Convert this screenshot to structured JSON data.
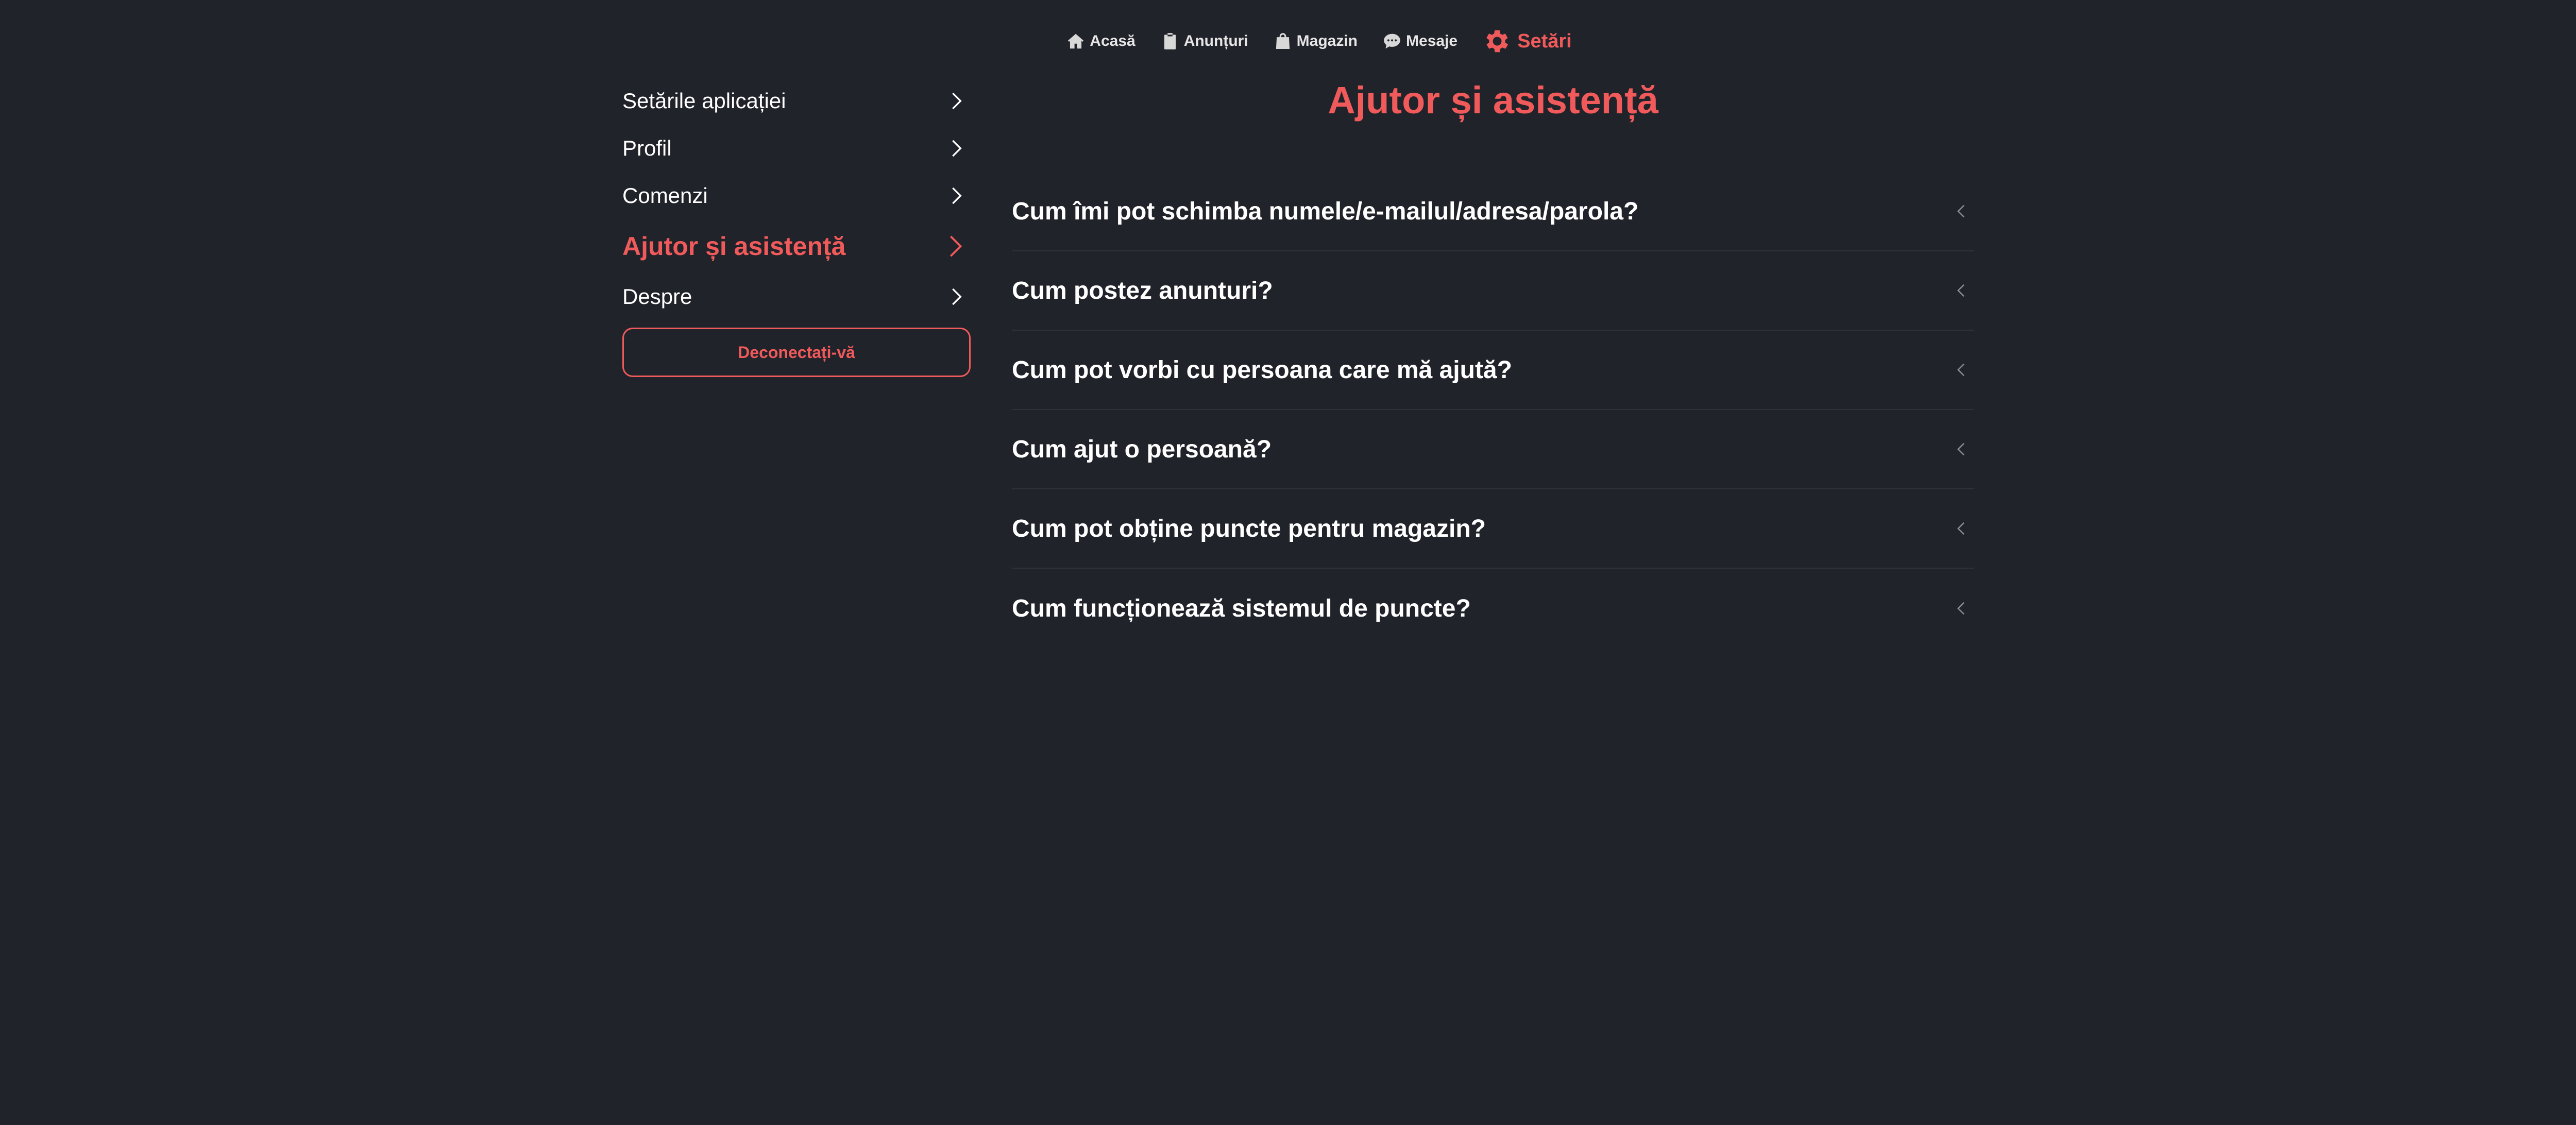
{
  "colors": {
    "background": "#21232a",
    "accent": "#f05a5b",
    "text": "#ffffff",
    "nav_text": "#e6e6e6",
    "divider": "#2f323a"
  },
  "topnav": {
    "items": [
      {
        "label": "Acasă",
        "icon": "home-icon",
        "active": false
      },
      {
        "label": "Anunțuri",
        "icon": "clipboard-icon",
        "active": false
      },
      {
        "label": "Magazin",
        "icon": "shopping-bag-icon",
        "active": false
      },
      {
        "label": "Mesaje",
        "icon": "chat-bubble-icon",
        "active": false
      },
      {
        "label": "Setări",
        "icon": "gear-icon",
        "active": true
      }
    ]
  },
  "sidebar": {
    "items": [
      {
        "label": "Setările aplicației",
        "active": false
      },
      {
        "label": "Profil",
        "active": false
      },
      {
        "label": "Comenzi",
        "active": false
      },
      {
        "label": "Ajutor și asistență",
        "active": true
      },
      {
        "label": "Despre",
        "active": false
      }
    ],
    "logout_label": "Deconectați-vă"
  },
  "main": {
    "title": "Ajutor și asistență",
    "faq": [
      {
        "question": "Cum îmi pot schimba numele/e-mailul/adresa/parola?",
        "expanded": false
      },
      {
        "question": "Cum postez anunturi?",
        "expanded": false
      },
      {
        "question": "Cum pot vorbi cu persoana care mă ajută?",
        "expanded": false
      },
      {
        "question": "Cum ajut o persoană?",
        "expanded": false
      },
      {
        "question": "Cum pot obține puncte pentru magazin?",
        "expanded": false
      },
      {
        "question": "Cum funcționează sistemul de puncte?",
        "expanded": false
      }
    ]
  }
}
